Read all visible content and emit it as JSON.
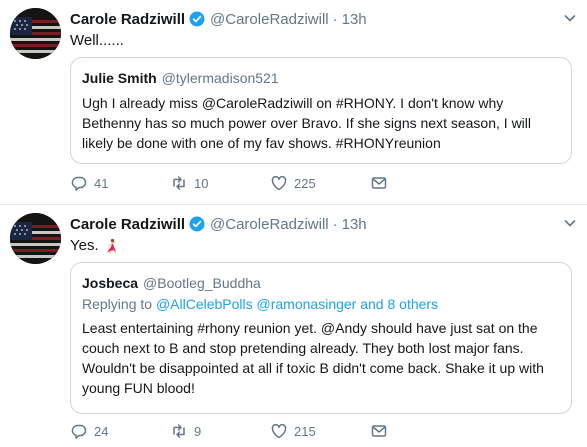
{
  "tweets": [
    {
      "name": "Carole Radziwill",
      "handle": "@CaroleRadziwill",
      "time": "13h",
      "text": "Well......",
      "quote": {
        "name": "Julie Smith",
        "handle": "@tylermadison521",
        "body": "Ugh I already miss @CaroleRadziwill on #RHONY. I don't know why Bethenny has so much power over Bravo. If she signs next season, I will likely be done with one of my fav shows. #RHONYreunion"
      },
      "replies": "41",
      "retweets": "10",
      "likes": "225"
    },
    {
      "name": "Carole Radziwill",
      "handle": "@CaroleRadziwill",
      "time": "13h",
      "text": "Yes.",
      "emoji": "dancer-emoji",
      "quote": {
        "name": "Josbeca",
        "handle": "@Bootleg_Buddha",
        "reply_prefix": "Replying to",
        "reply_to": "@AllCelebPolls @ramonasinger",
        "reply_others": "and 8 others",
        "body": "Least entertaining #rhony reunion yet. @Andy should have just sat on the couch next to B and stop pretending already. They both lost major fans. Wouldn't be disappointed at all if toxic B didn't come back. Shake it up with young FUN blood!"
      },
      "replies": "24",
      "retweets": "9",
      "likes": "215"
    }
  ],
  "separator": "·",
  "colors": {
    "text": "#14171a",
    "secondary": "#657786",
    "link": "#1da1f2",
    "border": "#e6ecf0",
    "quote_border": "#ccd6dd"
  },
  "icons": [
    "us-flag-avatar",
    "verified-badge-icon",
    "caret-down-icon",
    "reply-icon",
    "retweet-icon",
    "like-icon",
    "message-icon"
  ]
}
